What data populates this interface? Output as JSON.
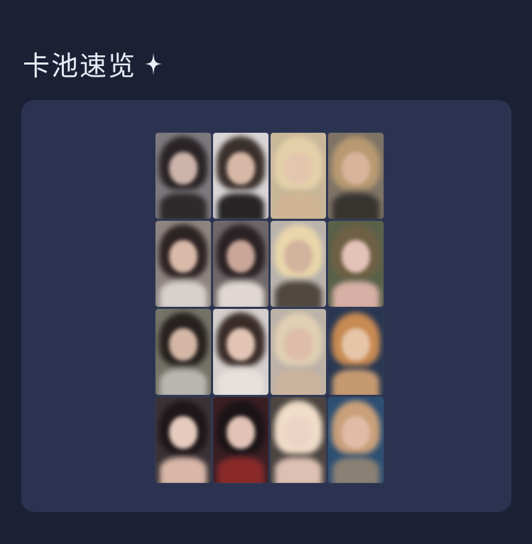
{
  "header": {
    "title": "卡池速览"
  },
  "sparkle_icon": "sparkle-icon",
  "colors": {
    "background": "#1b2035",
    "panel": "#2b3350",
    "title": "#e9ecf5"
  },
  "cards": [
    {
      "bg": "#7d7a7f",
      "hair": "#2a2426",
      "face": "#cbb3aa",
      "body": "#2d2a2c"
    },
    {
      "bg": "#d9d5d6",
      "hair": "#3a302c",
      "face": "#d7b8a6",
      "body": "#262424"
    },
    {
      "bg": "#c9b79a",
      "hair": "#e4d1a9",
      "face": "#e3c6ad",
      "body": "#cfb494"
    },
    {
      "bg": "#7e7365",
      "hair": "#b89a72",
      "face": "#d8b49b",
      "body": "#37332f"
    },
    {
      "bg": "#8f8580",
      "hair": "#2c2323",
      "face": "#d9b9a8",
      "body": "#d7d0cc"
    },
    {
      "bg": "#6f6869",
      "hair": "#2a2224",
      "face": "#caa698",
      "body": "#e0d7d2"
    },
    {
      "bg": "#b9b3ad",
      "hair": "#ead6aa",
      "face": "#d2b39e",
      "body": "#4f4740"
    },
    {
      "bg": "#5a6149",
      "hair": "#6f6045",
      "face": "#e3c2b8",
      "body": "#d6b0a4"
    },
    {
      "bg": "#747367",
      "hair": "#27211f",
      "face": "#d3b6a4",
      "body": "#b9b7b2"
    },
    {
      "bg": "#d4cfcc",
      "hair": "#3a2c28",
      "face": "#e2c5b5",
      "body": "#e6e0dc"
    },
    {
      "bg": "#bcb2a8",
      "hair": "#e0cfb3",
      "face": "#ddbca9",
      "body": "#cbb39d"
    },
    {
      "bg": "#2a3752",
      "hair": "#c78a52",
      "face": "#e6c4a8",
      "body": "#c59a70"
    },
    {
      "bg": "#3a3236",
      "hair": "#1e1719",
      "face": "#e5cabd",
      "body": "#d8b7a8"
    },
    {
      "bg": "#3a1f25",
      "hair": "#1b1416",
      "face": "#e2c2b6",
      "body": "#8a2a2a"
    },
    {
      "bg": "#4b4440",
      "hair": "#f0ddc8",
      "face": "#ecd3c6",
      "body": "#dcc0b2"
    },
    {
      "bg": "#2d4f72",
      "hair": "#c9a07a",
      "face": "#e0bca7",
      "body": "#8a8073"
    }
  ]
}
